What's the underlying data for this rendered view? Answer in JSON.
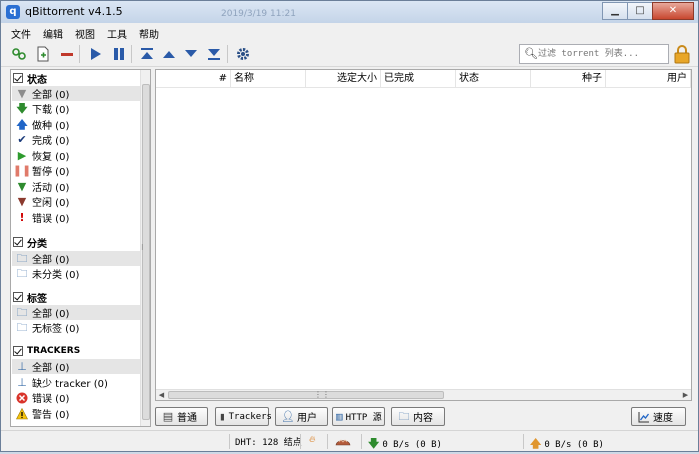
{
  "window": {
    "title": "qBittorrent v4.1.5",
    "ghost_text": "2019/3/19 11:21"
  },
  "menu": [
    "文件",
    "编辑",
    "视图",
    "工具",
    "帮助"
  ],
  "search": {
    "placeholder": "过滤 torrent 列表..."
  },
  "sidebar": {
    "status": {
      "header": "状态",
      "items": [
        {
          "label": "全部 (0)",
          "icon": "filter-icon",
          "color": "#8c8c8c"
        },
        {
          "label": "下载 (0)",
          "icon": "arrow-down-icon",
          "color": "#2e8b2e"
        },
        {
          "label": "做种 (0)",
          "icon": "arrow-up-icon",
          "color": "#2166c7"
        },
        {
          "label": "完成 (0)",
          "icon": "checkmark-icon",
          "color": "#1a3a7a"
        },
        {
          "label": "恢复 (0)",
          "icon": "play-icon",
          "color": "#2e9b2e"
        },
        {
          "label": "暂停 (0)",
          "icon": "pause-icon",
          "color": "#e07a6a"
        },
        {
          "label": "活动 (0)",
          "icon": "filter-icon",
          "color": "#2e8b2e"
        },
        {
          "label": "空闲 (0)",
          "icon": "filter-icon",
          "color": "#8b3a2e"
        },
        {
          "label": "错误 (0)",
          "icon": "exclamation-icon",
          "color": "#d00000"
        }
      ]
    },
    "categories": {
      "header": "分类",
      "items": [
        {
          "label": "全部 (0)",
          "icon": "folder-icon"
        },
        {
          "label": "未分类 (0)",
          "icon": "folder-icon"
        }
      ]
    },
    "tags": {
      "header": "标签",
      "items": [
        {
          "label": "全部 (0)",
          "icon": "folder-icon"
        },
        {
          "label": "无标签 (0)",
          "icon": "folder-icon"
        }
      ]
    },
    "trackers": {
      "header": "TRACKERS",
      "items": [
        {
          "label": "全部 (0)",
          "icon": "network-icon"
        },
        {
          "label": "缺少 tracker (0)",
          "icon": "network-icon"
        },
        {
          "label": "错误 (0)",
          "icon": "error-circle-icon"
        },
        {
          "label": "警告 (0)",
          "icon": "warning-icon"
        }
      ]
    }
  },
  "table": {
    "columns": [
      "#",
      "名称",
      "选定大小",
      "已完成",
      "状态",
      "种子",
      "用户"
    ]
  },
  "bottom_tabs": [
    {
      "label": "普通",
      "icon": "general-icon"
    },
    {
      "label": "Trackers",
      "icon": "trackers-icon"
    },
    {
      "label": "用户",
      "icon": "peers-icon"
    },
    {
      "label": "HTTP 源",
      "icon": "http-icon"
    },
    {
      "label": "内容",
      "icon": "folder-icon"
    }
  ],
  "speed_tab": {
    "label": "速度",
    "icon": "speed-chart-icon"
  },
  "status": {
    "dht": "DHT: 128 结点",
    "download": "0  B/s (0  B)",
    "upload": "0  B/s (0  B)"
  },
  "colors": {
    "accent": "#2166c7",
    "download": "#2e8b2e",
    "upload": "#e0962e"
  }
}
